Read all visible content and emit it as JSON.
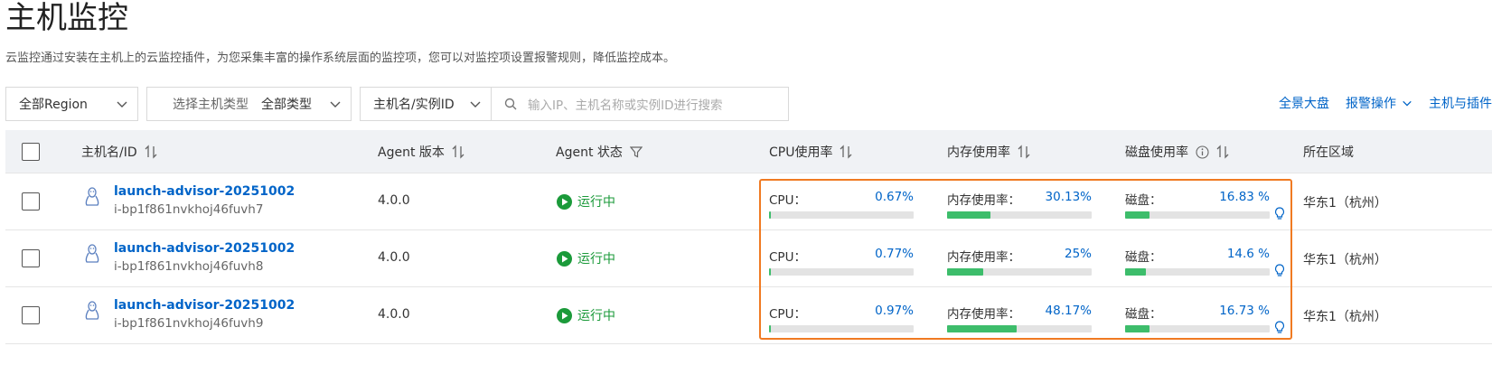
{
  "page": {
    "title": "主机监控",
    "description": "云监控通过安装在主机上的云监控插件，为您采集丰富的操作系统层面的监控项，您可以对监控项设置报警规则，降低监控成本。"
  },
  "filters": {
    "region": "全部Region",
    "host_type_label": "选择主机类型",
    "host_type_value": "全部类型",
    "search_field": "主机名/实例ID",
    "search_placeholder": "输入IP、主机名称或实例ID进行搜索"
  },
  "toolbar": {
    "panorama": "全景大盘",
    "alarm_ops": "报警操作",
    "host_plugin": "主机与插件"
  },
  "table": {
    "columns": {
      "host": "主机名/ID",
      "agent_version": "Agent 版本",
      "agent_status": "Agent 状态",
      "cpu": "CPU使用率",
      "memory": "内存使用率",
      "disk": "磁盘使用率",
      "region": "所在区域"
    },
    "rows": [
      {
        "name": "launch-advisor-20251002",
        "id": "i-bp1f861nvkhoj46fuvh7",
        "agent_version": "4.0.0",
        "status": "运行中",
        "cpu_label": "CPU：",
        "cpu_value": "0.67%",
        "cpu_pct": 0.67,
        "mem_label": "内存使用率：",
        "mem_value": "30.13%",
        "mem_pct": 30.13,
        "disk_label": "磁盘：",
        "disk_value": "16.83 %",
        "disk_pct": 16.83,
        "region": "华东1（杭州）"
      },
      {
        "name": "launch-advisor-20251002",
        "id": "i-bp1f861nvkhoj46fuvh8",
        "agent_version": "4.0.0",
        "status": "运行中",
        "cpu_label": "CPU：",
        "cpu_value": "0.77%",
        "cpu_pct": 0.77,
        "mem_label": "内存使用率：",
        "mem_value": "25%",
        "mem_pct": 25,
        "disk_label": "磁盘：",
        "disk_value": "14.6 %",
        "disk_pct": 14.6,
        "region": "华东1（杭州）"
      },
      {
        "name": "launch-advisor-20251002",
        "id": "i-bp1f861nvkhoj46fuvh9",
        "agent_version": "4.0.0",
        "status": "运行中",
        "cpu_label": "CPU：",
        "cpu_value": "0.97%",
        "cpu_pct": 0.97,
        "mem_label": "内存使用率：",
        "mem_value": "48.17%",
        "mem_pct": 48.17,
        "disk_label": "磁盘：",
        "disk_value": "16.73 %",
        "disk_pct": 16.73,
        "region": "华东1（杭州）"
      }
    ]
  },
  "colors": {
    "link": "#0064c8",
    "running": "#1b9a3a",
    "bar_fill": "#3dbd6b",
    "highlight": "#f07a22"
  },
  "icons": [
    "chevron-down-icon",
    "search-icon",
    "sort-icon",
    "filter-icon",
    "info-icon",
    "linux-icon",
    "play-icon",
    "lightbulb-icon"
  ]
}
